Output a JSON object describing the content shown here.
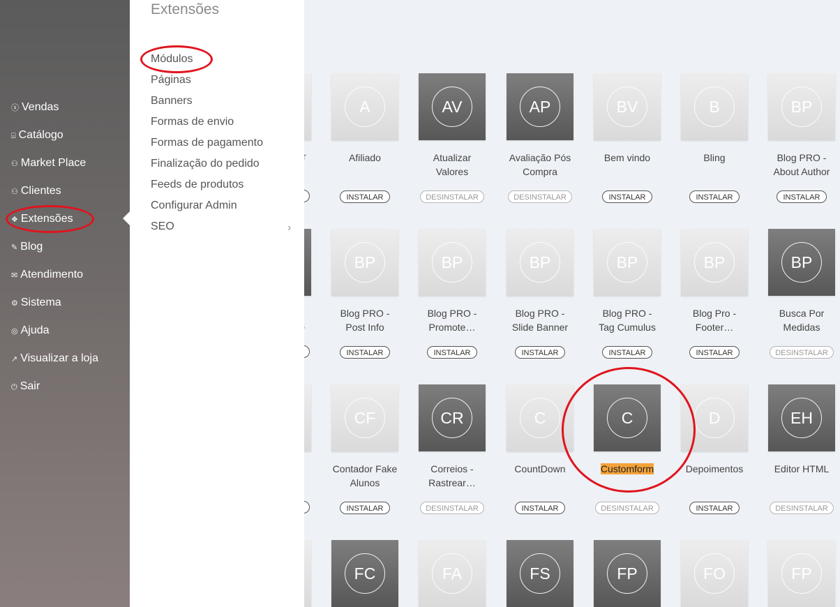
{
  "sidebar": {
    "items": [
      {
        "icon": "dollar-circle-icon",
        "glyph": "ⓢ",
        "label": "Vendas"
      },
      {
        "icon": "catalog-icon",
        "glyph": "⌸",
        "label": "Catálogo"
      },
      {
        "icon": "user-icon",
        "glyph": "⚇",
        "label": "Market Place"
      },
      {
        "icon": "user-icon",
        "glyph": "⚇",
        "label": "Clientes"
      },
      {
        "icon": "puzzle-icon",
        "glyph": "❖",
        "label": "Extensões"
      },
      {
        "icon": "pencil-icon",
        "glyph": "✎",
        "label": "Blog"
      },
      {
        "icon": "chat-icon",
        "glyph": "✉",
        "label": "Atendimento"
      },
      {
        "icon": "gear-icon",
        "glyph": "⚙",
        "label": "Sistema"
      },
      {
        "icon": "lifebuoy-icon",
        "glyph": "◎",
        "label": "Ajuda"
      },
      {
        "icon": "external-link-icon",
        "glyph": "↗",
        "label": "Visualizar a loja"
      },
      {
        "icon": "power-icon",
        "glyph": "⏻",
        "label": "Sair"
      }
    ]
  },
  "submenu": {
    "title": "Extensões",
    "items": [
      "Módulos",
      "Páginas",
      "Banners",
      "Formas de envio",
      "Formas de pagamento",
      "Finalização do pedido",
      "Feeds de produtos",
      "Configurar Admin",
      "SEO"
    ]
  },
  "buttons": {
    "install": "INSTALAR",
    "uninstall": "DESINSTALAR"
  },
  "partial": {
    "row1": "r",
    "row2": "s"
  },
  "modules": [
    {
      "initials": "A",
      "line1": "Afiliado",
      "line2": "",
      "dark": false,
      "installed": false
    },
    {
      "initials": "AV",
      "line1": "Atualizar",
      "line2": "Valores",
      "dark": true,
      "installed": true
    },
    {
      "initials": "AP",
      "line1": "Avaliação Pós",
      "line2": "Compra",
      "dark": true,
      "installed": true
    },
    {
      "initials": "BV",
      "line1": "Bem vindo",
      "line2": "",
      "dark": false,
      "installed": false
    },
    {
      "initials": "B",
      "line1": "Bling",
      "line2": "",
      "dark": false,
      "installed": false
    },
    {
      "initials": "BP",
      "line1": "Blog PRO -",
      "line2": "About Author",
      "dark": false,
      "installed": false
    },
    {
      "initials": "BP",
      "line1": "Blog PRO -",
      "line2": "Post Info",
      "dark": false,
      "installed": false
    },
    {
      "initials": "BP",
      "line1": "Blog PRO -",
      "line2": "Promote…",
      "dark": false,
      "installed": false
    },
    {
      "initials": "BP",
      "line1": "Blog PRO -",
      "line2": "Slide Banner",
      "dark": false,
      "installed": false
    },
    {
      "initials": "BP",
      "line1": "Blog PRO -",
      "line2": "Tag Cumulus",
      "dark": false,
      "installed": false
    },
    {
      "initials": "BP",
      "line1": "Blog Pro -",
      "line2": "Footer…",
      "dark": false,
      "installed": false
    },
    {
      "initials": "BP",
      "line1": "Busca Por",
      "line2": "Medidas",
      "dark": true,
      "installed": true
    },
    {
      "initials": "CF",
      "line1": "Contador Fake",
      "line2": "Alunos",
      "dark": false,
      "installed": false
    },
    {
      "initials": "CR",
      "line1": "Correios -",
      "line2": "Rastrear…",
      "dark": true,
      "installed": true
    },
    {
      "initials": "C",
      "line1": "CountDown",
      "line2": "",
      "dark": false,
      "installed": false
    },
    {
      "initials": "C",
      "line1": "Customform",
      "line2": "",
      "dark": true,
      "installed": true,
      "highlight": true
    },
    {
      "initials": "D",
      "line1": "Depoimentos",
      "line2": "",
      "dark": false,
      "installed": false
    },
    {
      "initials": "EH",
      "line1": "Editor HTML",
      "line2": "",
      "dark": true,
      "installed": true
    },
    {
      "initials": "FC",
      "line1": "",
      "line2": "",
      "dark": true,
      "installed": true
    },
    {
      "initials": "FA",
      "line1": "",
      "line2": "",
      "dark": false,
      "installed": false
    },
    {
      "initials": "FS",
      "line1": "",
      "line2": "",
      "dark": true,
      "installed": true
    },
    {
      "initials": "FP",
      "line1": "",
      "line2": "",
      "dark": true,
      "installed": true
    },
    {
      "initials": "FO",
      "line1": "",
      "line2": "",
      "dark": false,
      "installed": false
    },
    {
      "initials": "FP",
      "line1": "",
      "line2": "",
      "dark": false,
      "installed": false
    }
  ],
  "partial_tiles": [
    {
      "dark": false
    },
    {
      "dark": true
    },
    {
      "dark": false
    },
    {
      "dark": false
    }
  ]
}
